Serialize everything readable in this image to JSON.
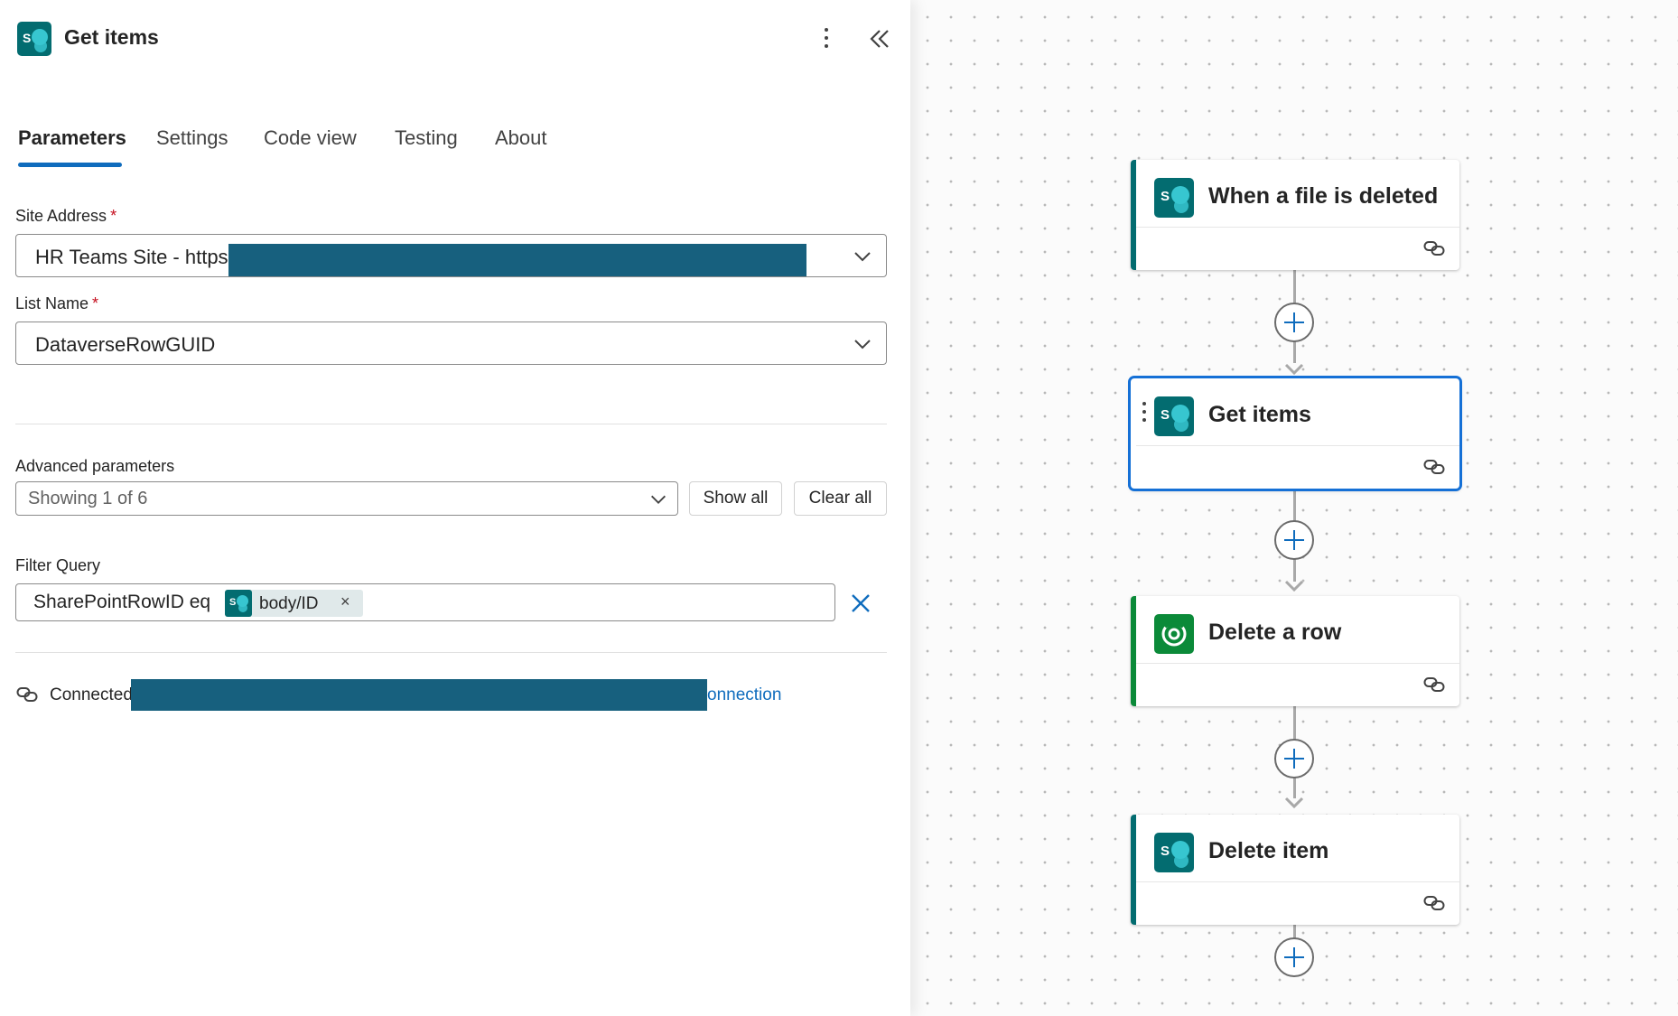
{
  "panel": {
    "title": "Get items",
    "tabs": [
      {
        "label": "Parameters",
        "active": true
      },
      {
        "label": "Settings",
        "active": false
      },
      {
        "label": "Code view",
        "active": false
      },
      {
        "label": "Testing",
        "active": false
      },
      {
        "label": "About",
        "active": false
      }
    ],
    "site_address": {
      "label": "Site Address",
      "required_mark": "*",
      "value": "HR Teams Site - https"
    },
    "list_name": {
      "label": "List Name",
      "required_mark": "*",
      "value": "DataverseRowGUID"
    },
    "advanced": {
      "label": "Advanced parameters",
      "value": "Showing 1 of 6",
      "show_all": "Show all",
      "clear_all": "Clear all"
    },
    "filter_query": {
      "label": "Filter Query",
      "text": "SharePointRowID eq",
      "token": "body/ID",
      "token_remove": "×"
    },
    "connection": {
      "prefix": "Connected",
      "suffix": "onnection"
    }
  },
  "flow": {
    "steps": [
      {
        "title": "When a file is deleted",
        "icon": "sharepoint-icon",
        "accent": "#036C70"
      },
      {
        "title": "Get items",
        "icon": "sharepoint-icon",
        "accent": "#1570D6",
        "selected": true
      },
      {
        "title": "Delete a row",
        "icon": "dataverse-icon",
        "accent": "#0B8A39"
      },
      {
        "title": "Delete item",
        "icon": "sharepoint-icon",
        "accent": "#036C70"
      }
    ]
  },
  "colors": {
    "sharepoint": "#036C70",
    "dataverse": "#0B8A39",
    "accent_blue": "#0F6CBD",
    "redaction": "#17607E"
  }
}
